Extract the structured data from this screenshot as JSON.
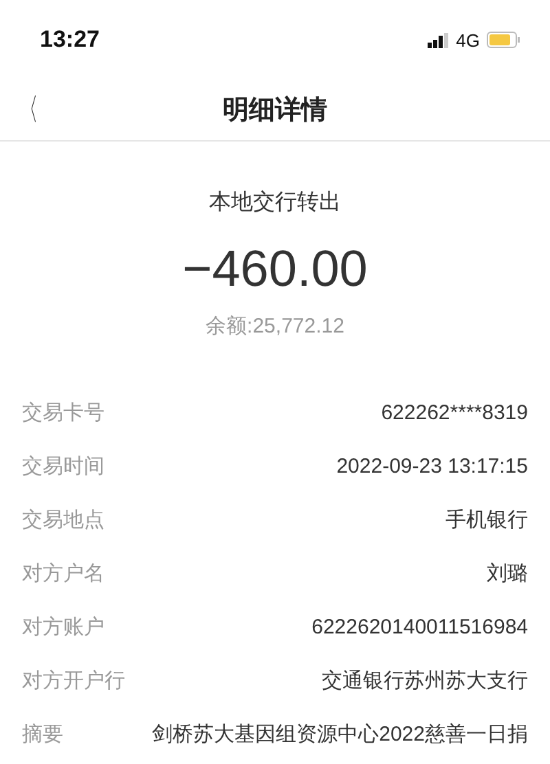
{
  "status_bar": {
    "time": "13:27",
    "network": "4G"
  },
  "nav": {
    "back": "〈",
    "title": "明细详情"
  },
  "summary": {
    "type": "本地交行转出",
    "amount": "−460.00",
    "balance": "余额:25,772.12"
  },
  "details": [
    {
      "label": "交易卡号",
      "value": "622262****8319"
    },
    {
      "label": "交易时间",
      "value": "2022-09-23 13:17:15"
    },
    {
      "label": "交易地点",
      "value": "手机银行"
    },
    {
      "label": "对方户名",
      "value": "刘璐"
    },
    {
      "label": "对方账户",
      "value": "6222620140011516984"
    },
    {
      "label": "对方开户行",
      "value": "交通银行苏州苏大支行"
    },
    {
      "label": "摘要",
      "value": "剑桥苏大基因组资源中心2022慈善一日捐"
    }
  ]
}
